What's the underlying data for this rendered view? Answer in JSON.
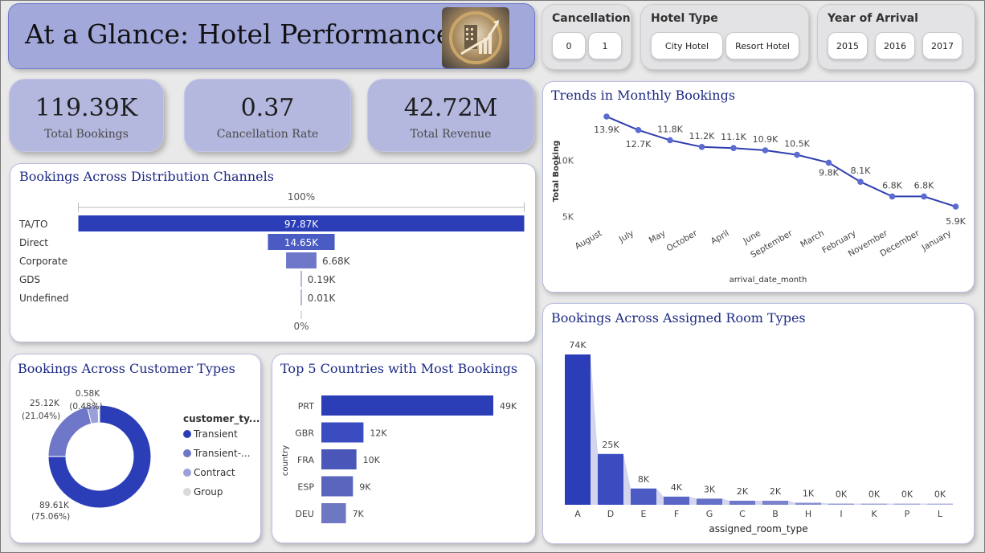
{
  "header": {
    "title": "At a Glance: Hotel Performance"
  },
  "kpis": [
    {
      "value": "119.39K",
      "label": "Total Bookings"
    },
    {
      "value": "0.37",
      "label": "Cancellation Rate"
    },
    {
      "value": "42.72M",
      "label": "Total Revenue"
    }
  ],
  "slicers": {
    "cancellation": {
      "title": "Cancellation",
      "options": [
        "0",
        "1"
      ]
    },
    "hotel_type": {
      "title": "Hotel Type",
      "options": [
        "City Hotel",
        "Resort Hotel"
      ]
    },
    "year": {
      "title": "Year of Arrival",
      "options": [
        "2015",
        "2016",
        "2017"
      ]
    }
  },
  "colors": {
    "primary": "#2b3eb8",
    "mid": "#4a5cc4",
    "light": "#6f78c8",
    "lighter": "#9aa0d8",
    "lightest": "#d9d9d9",
    "title": "#1d2a84"
  },
  "chart_data": [
    {
      "id": "distribution",
      "type": "bar",
      "title": "Bookings Across Distribution Channels",
      "top_label": "100%",
      "bottom_label": "0%",
      "categories": [
        "TA/TO",
        "Direct",
        "Corporate",
        "GDS",
        "Undefined"
      ],
      "values": [
        97.87,
        14.65,
        6.68,
        0.19,
        0.01
      ],
      "labels": [
        "97.87K",
        "14.65K",
        "6.68K",
        "0.19K",
        "0.01K"
      ],
      "unit": "K"
    },
    {
      "id": "monthly",
      "type": "line",
      "title": "Trends in Monthly Bookings",
      "xlabel": "arrival_date_month",
      "ylabel": "Total Booking",
      "categories": [
        "August",
        "July",
        "May",
        "October",
        "April",
        "June",
        "September",
        "March",
        "February",
        "November",
        "December",
        "January"
      ],
      "values": [
        13.9,
        12.7,
        11.8,
        11.2,
        11.1,
        10.9,
        10.5,
        9.8,
        8.1,
        6.8,
        6.8,
        5.9
      ],
      "labels": [
        "13.9K",
        "12.7K",
        "11.8K",
        "11.2K",
        "11.1K",
        "10.9K",
        "10.5K",
        "9.8K",
        "8.1K",
        "6.8K",
        "6.8K",
        "5.9K"
      ],
      "yticks": [
        {
          "v": 10,
          "t": "10K"
        },
        {
          "v": 5,
          "t": "5K"
        }
      ]
    },
    {
      "id": "customer_types",
      "type": "pie",
      "title": "Bookings Across Customer Types",
      "legend_title": "customer_ty...",
      "slices": [
        {
          "name": "Transient",
          "value": 89.61,
          "label": "89.61K",
          "pct": "(75.06%)"
        },
        {
          "name": "Transient-...",
          "value": 25.12,
          "label": "25.12K",
          "pct": "(21.04%)"
        },
        {
          "name": "Contract",
          "value": 4.08,
          "label": "",
          "pct": ""
        },
        {
          "name": "Group",
          "value": 0.58,
          "label": "0.58K",
          "pct": "(0.48%)"
        }
      ]
    },
    {
      "id": "countries",
      "type": "bar",
      "title": "Top 5 Countries with Most Bookings",
      "ylabel": "country",
      "categories": [
        "PRT",
        "GBR",
        "FRA",
        "ESP",
        "DEU"
      ],
      "values": [
        49,
        12,
        10,
        9,
        7
      ],
      "labels": [
        "49K",
        "12K",
        "10K",
        "9K",
        "7K"
      ]
    },
    {
      "id": "room_types",
      "type": "bar",
      "title": "Bookings Across Assigned Room Types",
      "xlabel": "assigned_room_type",
      "categories": [
        "A",
        "D",
        "E",
        "F",
        "G",
        "C",
        "B",
        "H",
        "I",
        "K",
        "P",
        "L"
      ],
      "values": [
        74,
        25,
        8,
        4,
        3,
        2,
        2,
        1,
        0.4,
        0.3,
        0.1,
        0.05
      ],
      "labels": [
        "74K",
        "25K",
        "8K",
        "4K",
        "3K",
        "2K",
        "2K",
        "1K",
        "0K",
        "0K",
        "0K",
        "0K"
      ]
    }
  ]
}
